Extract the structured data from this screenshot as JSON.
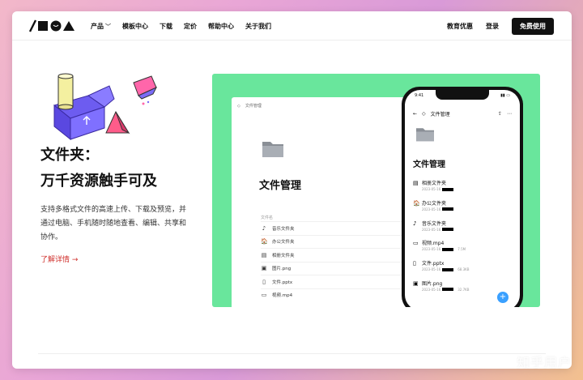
{
  "nav": {
    "links": [
      {
        "label": "产品",
        "has_dropdown": true
      },
      {
        "label": "模板中心"
      },
      {
        "label": "下载"
      },
      {
        "label": "定价"
      },
      {
        "label": "帮助中心"
      },
      {
        "label": "关于我们"
      }
    ],
    "edu": "教育优惠",
    "login": "登录",
    "free": "免费使用"
  },
  "hero": {
    "title_line1": "文件夹：",
    "title_line2": "万千资源触手可及",
    "description": "支持多格式文件的高速上传、下载及预览，并通过电脑、手机随时随地查看、编辑、共享和协作。",
    "more_link": "了解详情 →"
  },
  "desktop": {
    "breadcrumb": "文件管理",
    "title": "文件管理",
    "column_header": "文件名",
    "files": [
      {
        "icon": "music-icon",
        "glyph": "♪",
        "name": "音乐文件夹"
      },
      {
        "icon": "office-icon",
        "glyph": "🏠",
        "name": "办公文件夹"
      },
      {
        "icon": "album-icon",
        "glyph": "▤",
        "name": "相册文件夹"
      },
      {
        "icon": "image-icon",
        "glyph": "▣",
        "name": "图片.png"
      },
      {
        "icon": "doc-icon",
        "glyph": "▯",
        "name": "文件.pptx"
      },
      {
        "icon": "video-icon",
        "glyph": "▭",
        "name": "视频.mp4"
      }
    ]
  },
  "phone": {
    "time": "9:41",
    "title_bar": "文件管理",
    "title": "文件管理",
    "files": [
      {
        "icon": "album-icon",
        "glyph": "▤",
        "name": "相册文件夹",
        "date": "2023-05-16",
        "size": ""
      },
      {
        "icon": "office-icon",
        "glyph": "🏠",
        "name": "办公文件夹",
        "date": "2023-05-16",
        "size": ""
      },
      {
        "icon": "music-icon",
        "glyph": "♪",
        "name": "音乐文件夹",
        "date": "2023-05-16",
        "size": ""
      },
      {
        "icon": "video-icon",
        "glyph": "▭",
        "name": "视频.mp4",
        "date": "2023-05-16",
        "size": "7.5M"
      },
      {
        "icon": "doc-icon",
        "glyph": "▯",
        "name": "文件.pptx",
        "date": "2023-05-16",
        "size": "68.3KB"
      },
      {
        "icon": "image-icon",
        "glyph": "▣",
        "name": "图片.png",
        "date": "2023-05-16",
        "size": "32.7KB"
      }
    ],
    "fab": "+"
  },
  "watermark": "知乎用户",
  "colors": {
    "showcase_green": "#69e69c",
    "link_red": "#d0312d",
    "fab_blue": "#3aa0ff"
  }
}
